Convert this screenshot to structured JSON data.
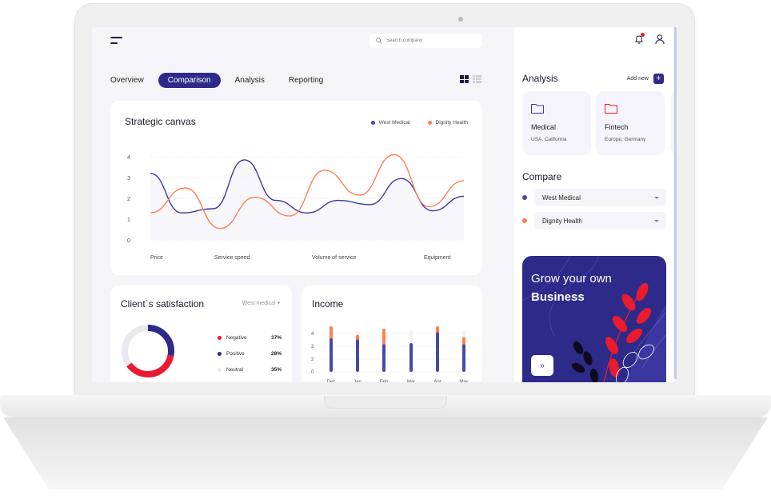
{
  "header": {
    "search_placeholder": "Search company"
  },
  "tabs": [
    {
      "label": "Overview",
      "active": false
    },
    {
      "label": "Comparison",
      "active": true
    },
    {
      "label": "Analysis",
      "active": false
    },
    {
      "label": "Reporting",
      "active": false
    }
  ],
  "colors": {
    "primary": "#2e2a8a",
    "west_medical": "#3d3a9e",
    "dignity_health": "#ff7f50",
    "negative": "#ea1b2e",
    "neutral": "#e8e8ee"
  },
  "strategic": {
    "title": "Strategic canvas",
    "legend": [
      {
        "name": "West Medical",
        "color": "#4a47a8"
      },
      {
        "name": "Dignity Health",
        "color": "#ff7f50"
      }
    ]
  },
  "satisfaction": {
    "title": "Client`s satisfaction",
    "filter": "West medical",
    "items": [
      {
        "label": "Negative",
        "value": "37%",
        "pct": 37,
        "color": "#ea1b2e"
      },
      {
        "label": "Positive",
        "value": "28%",
        "pct": 28,
        "color": "#2e2a8a"
      },
      {
        "label": "Neutral",
        "value": "35%",
        "pct": 35,
        "color": "#e8e8ee"
      }
    ]
  },
  "income": {
    "title": "Income"
  },
  "side": {
    "analysis_title": "Analysis",
    "add_new_label": "Add new",
    "folders": [
      {
        "name": "Medical",
        "location": "USA, California",
        "color": "#3d3a9e"
      },
      {
        "name": "Fintech",
        "location": "Europe, Germany",
        "color": "#ea1b2e"
      }
    ],
    "compare_title": "Compare",
    "compare": [
      {
        "label": "West Medical",
        "color": "#4a47a8"
      },
      {
        "label": "Dignity Health",
        "color": "#ff7f50"
      }
    ],
    "promo_line1": "Grow your own",
    "promo_line2": "Business",
    "promo_button": "»"
  },
  "chart_data": [
    {
      "type": "line",
      "title": "Strategic canvas",
      "x": [
        "Price",
        "",
        "",
        "Service speed",
        "",
        "",
        "Volume of service",
        "",
        "",
        "Equipment",
        "",
        ""
      ],
      "xtick_labels": [
        "Price",
        "Service speed",
        "Volume of service",
        "Equipment"
      ],
      "yticks": [
        0,
        1,
        2,
        3,
        4
      ],
      "ylim": [
        0,
        4.3
      ],
      "grid": true,
      "legend_position": "top-right",
      "series": [
        {
          "name": "West Medical",
          "color": "#3d3a9e",
          "values": [
            3.2,
            1.3,
            1.5,
            3.85,
            1.9,
            1.3,
            1.9,
            1.7,
            2.95,
            1.4,
            2.1
          ]
        },
        {
          "name": "Dignity Health",
          "color": "#ff7f50",
          "values": [
            1.3,
            2.5,
            0.55,
            2.05,
            1.15,
            3.35,
            2.15,
            4.1,
            1.6,
            2.85
          ]
        }
      ]
    },
    {
      "type": "pie",
      "title": "Client`s satisfaction",
      "categories": [
        "Negative",
        "Positive",
        "Neutral"
      ],
      "values": [
        37,
        28,
        35
      ]
    },
    {
      "type": "bar",
      "title": "Income",
      "categories": [
        "Dec",
        "Jan",
        "Feb",
        "Mar",
        "Apr",
        "May"
      ],
      "yticks": [
        0,
        2,
        3,
        4
      ],
      "ylim": [
        0,
        4
      ],
      "series": [
        {
          "name": "base",
          "color": "#4a47a8",
          "values": [
            2.8,
            2.7,
            2.3,
            2.4,
            3.3,
            2.3
          ]
        },
        {
          "name": "extra",
          "color": "#ff7f50",
          "values": [
            1.0,
            0.4,
            1.3,
            0.0,
            0.5,
            0.6
          ]
        }
      ]
    }
  ]
}
